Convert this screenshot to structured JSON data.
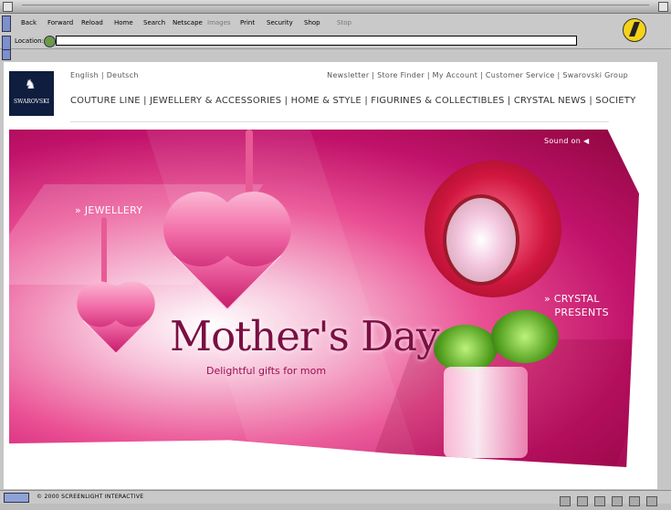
{
  "browser": {
    "toolbar": [
      "Back",
      "Forward",
      "Reload",
      "Home",
      "Search",
      "Netscape",
      "Images",
      "Print",
      "Security",
      "Shop",
      "Stop"
    ],
    "location_label": "Location:",
    "location_value": "",
    "status_text": "© 2000 SCREENLIGHT INTERACTIVE"
  },
  "site": {
    "logo_text": "SWAROVSKI",
    "language_links": [
      "English",
      "Deutsch"
    ],
    "utility_links": [
      "Newsletter",
      "Store Finder",
      "My Account",
      "Customer Service",
      "Swarovski Group"
    ],
    "nav_links": [
      "COUTURE LINE",
      "JEWELLERY & ACCESSORIES",
      "HOME & STYLE",
      "FIGURINES & COLLECTIBLES",
      "CRYSTAL NEWS",
      "SOCIETY"
    ]
  },
  "hero": {
    "sound": "Sound on",
    "jewellery": "JEWELLERY",
    "crystal_line1": "CRYSTAL",
    "crystal_line2": "PRESENTS",
    "title": "Mother's Day",
    "subtitle": "Delightful gifts for mom"
  }
}
